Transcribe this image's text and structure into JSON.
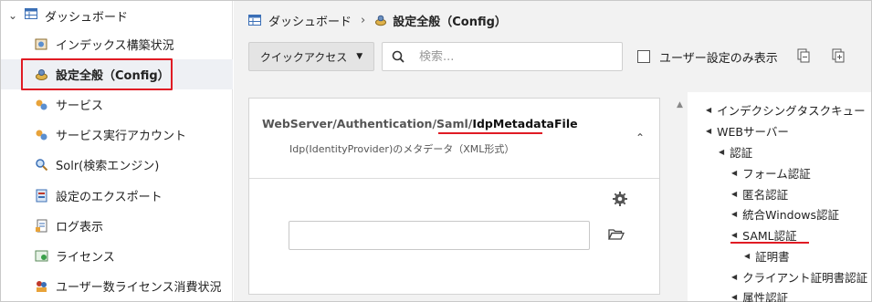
{
  "sidebar": {
    "root_label": "ダッシュボード",
    "items": [
      {
        "label": "インデックス構築状況",
        "icon": "index-icon"
      },
      {
        "label": "設定全般（Config）",
        "icon": "config-icon",
        "active": true
      },
      {
        "label": "サービス",
        "icon": "service-icon"
      },
      {
        "label": "サービス実行アカウント",
        "icon": "service-account-icon"
      },
      {
        "label": "Solr(検索エンジン)",
        "icon": "search-engine-icon"
      },
      {
        "label": "設定のエクスポート",
        "icon": "export-icon"
      },
      {
        "label": "ログ表示",
        "icon": "log-icon"
      },
      {
        "label": "ライセンス",
        "icon": "license-icon"
      },
      {
        "label": "ユーザー数ライセンス消費状況",
        "icon": "user-license-icon"
      }
    ]
  },
  "breadcrumb": {
    "root": "ダッシュボード",
    "separator": "›",
    "current": "設定全般（Config）"
  },
  "toolbar": {
    "quick_access": "クイックアクセス",
    "search_placeholder": "検索...",
    "user_only_label": "ユーザー設定のみ表示"
  },
  "setting": {
    "path_prefix": "WebServer/Authentication/Saml/",
    "key": "IdpMetadataFile",
    "description": "Idp(IdentityProvider)のメタデータ（XML形式）",
    "value": ""
  },
  "tree": [
    {
      "label": "インデクシングタスクキュー",
      "level": 0,
      "arrow": true
    },
    {
      "label": "WEBサーバー",
      "level": 0,
      "arrow": true
    },
    {
      "label": "認証",
      "level": 1,
      "arrow": true
    },
    {
      "label": "フォーム認証",
      "level": 2,
      "arrow": true
    },
    {
      "label": "匿名認証",
      "level": 2,
      "arrow": true
    },
    {
      "label": "統合Windows認証",
      "level": 2,
      "arrow": true
    },
    {
      "label": "SAML認証",
      "level": 2,
      "arrow": true
    },
    {
      "label": "証明書",
      "level": 3,
      "arrow": false
    },
    {
      "label": "クライアント証明書認証",
      "level": 2,
      "arrow": true
    },
    {
      "label": "属性認証",
      "level": 2,
      "arrow": true
    }
  ],
  "colors": {
    "highlight_red": "#e01b24",
    "active_bg": "#eef0f4"
  }
}
